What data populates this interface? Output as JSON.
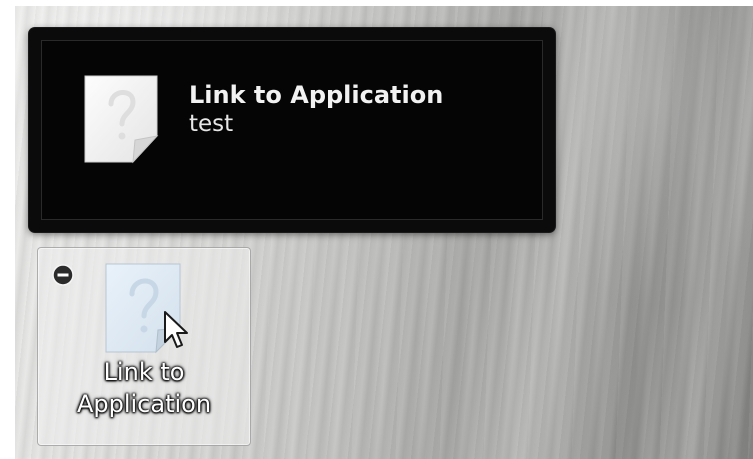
{
  "tooltip": {
    "title": "Link to Application",
    "subtitle": "test",
    "icon": "unknown-file-icon"
  },
  "desktop_item": {
    "label_line1": "Link to",
    "label_line2": "Application",
    "icon": "unknown-file-icon",
    "remove_icon": "remove-minus-icon",
    "cursor_icon": "pointer-cursor-icon"
  }
}
